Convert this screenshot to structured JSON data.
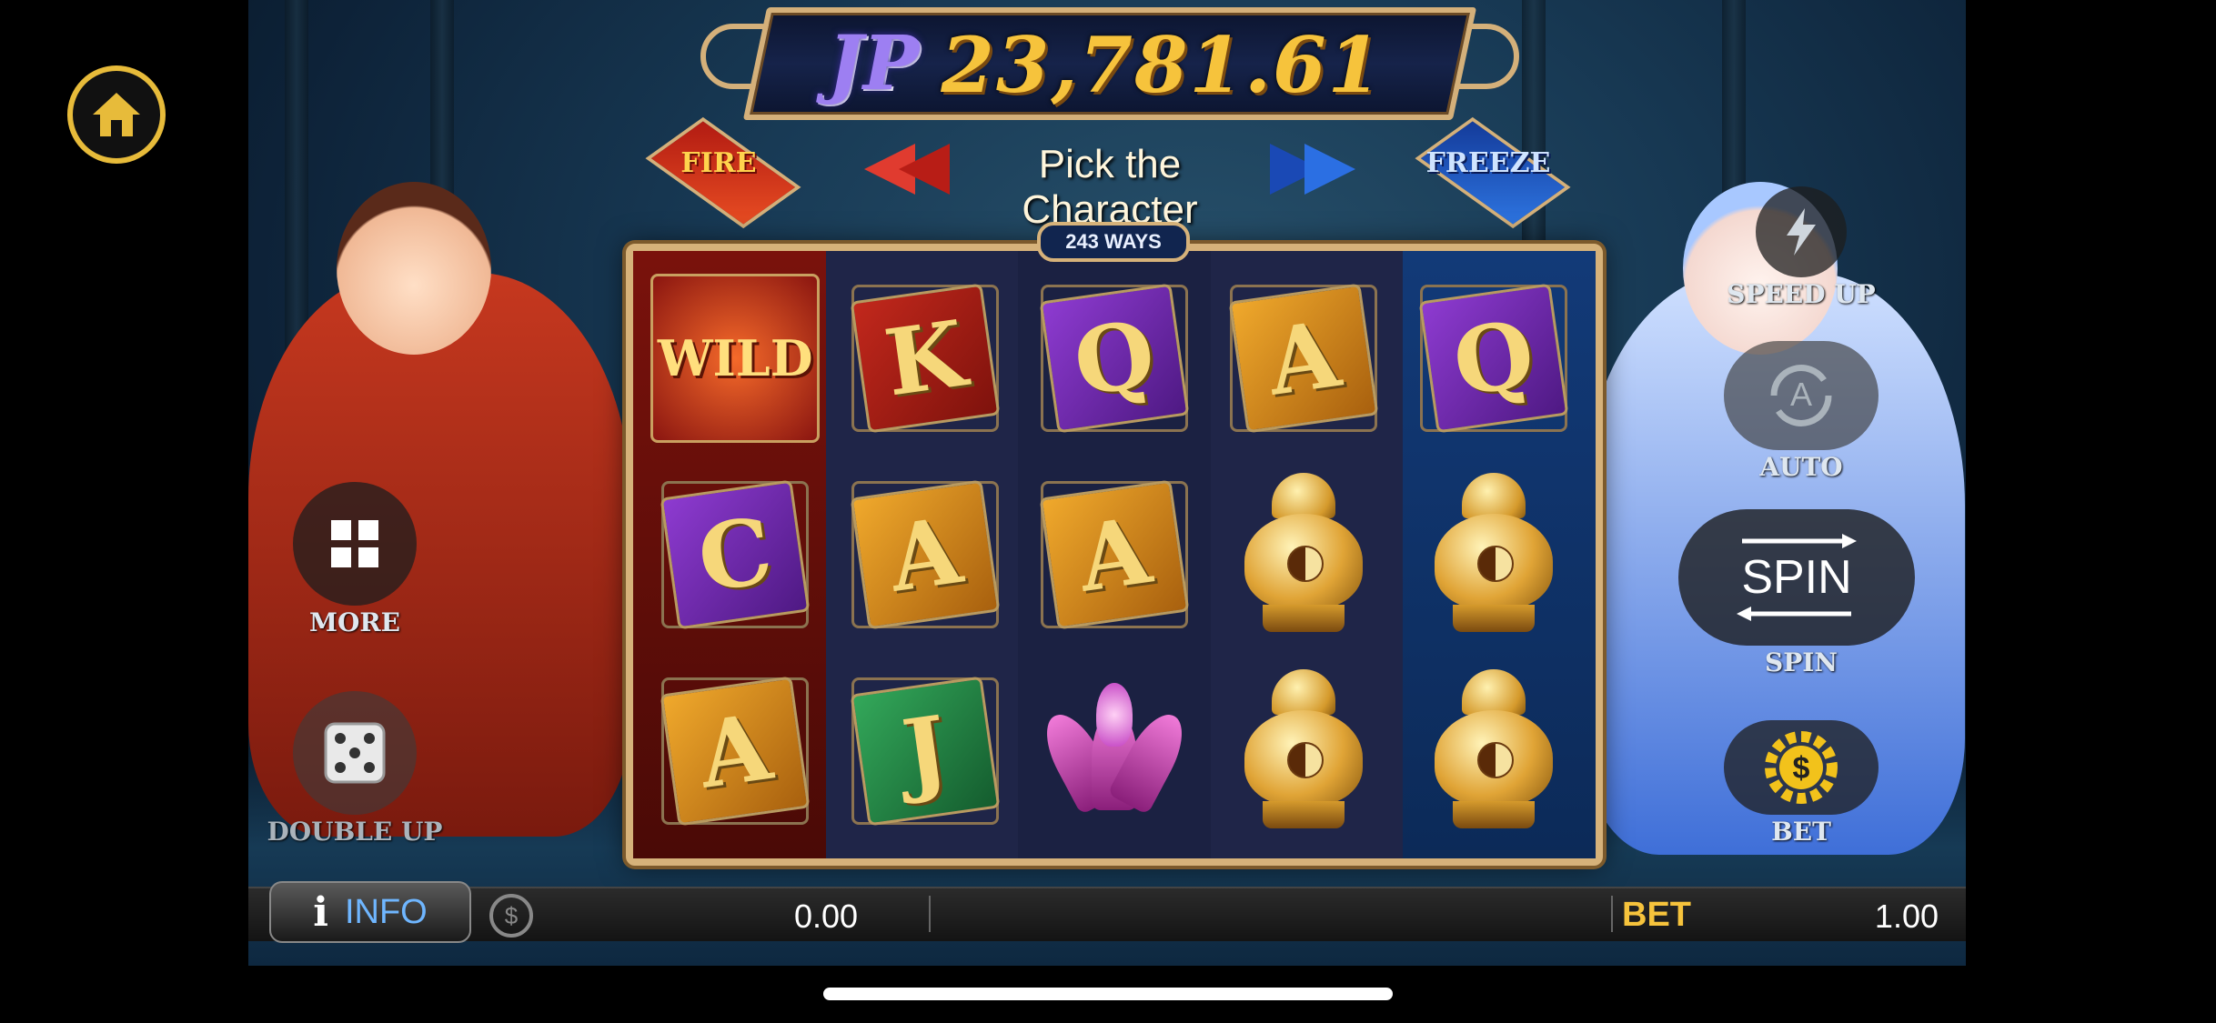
{
  "jackpot": {
    "label": "JP",
    "value": "23,781.61"
  },
  "characters": {
    "fire_label": "FIRE",
    "prompt": "Pick the Character",
    "freeze_label": "FREEZE"
  },
  "ways": "243 WAYS",
  "reels": [
    [
      {
        "symbol": "wild",
        "text": "WILD"
      },
      {
        "symbol": "card",
        "text": "C",
        "color": "purple"
      },
      {
        "symbol": "card",
        "text": "A",
        "color": "gold"
      }
    ],
    [
      {
        "symbol": "card",
        "text": "K",
        "color": "red"
      },
      {
        "symbol": "card",
        "text": "A",
        "color": "gold"
      },
      {
        "symbol": "card",
        "text": "J",
        "color": "green"
      }
    ],
    [
      {
        "symbol": "card",
        "text": "Q",
        "color": "purple"
      },
      {
        "symbol": "card",
        "text": "A",
        "color": "gold"
      },
      {
        "symbol": "lotus",
        "text": ""
      }
    ],
    [
      {
        "symbol": "card",
        "text": "A",
        "color": "gold"
      },
      {
        "symbol": "urn",
        "text": ""
      },
      {
        "symbol": "urn",
        "text": ""
      }
    ],
    [
      {
        "symbol": "card",
        "text": "Q",
        "color": "purple"
      },
      {
        "symbol": "urn",
        "text": ""
      },
      {
        "symbol": "urn",
        "text": ""
      }
    ]
  ],
  "controls": {
    "speed_up": "SPEED UP",
    "auto": "AUTO",
    "auto_icon_text": "A",
    "spin_button": "SPIN",
    "spin_label": "SPIN",
    "bet": "BET",
    "more": "MORE",
    "double_up": "DOUBLE UP"
  },
  "bottom_bar": {
    "info_icon": "i",
    "info": "INFO",
    "win_value": "0.00",
    "bet_label": "BET",
    "bet_value": "1.00"
  },
  "icons": [
    "home-icon",
    "lightning-icon",
    "auto-icon",
    "dollar-gear-icon",
    "grid-icon",
    "dice-icon",
    "coin-icon"
  ],
  "colors": {
    "gold": "#f6c33c",
    "jp_purple": "#9d7ff2",
    "info_blue": "#6fb6ff",
    "fire_red": "#e03b2f",
    "freeze_blue": "#2b6fe3"
  }
}
